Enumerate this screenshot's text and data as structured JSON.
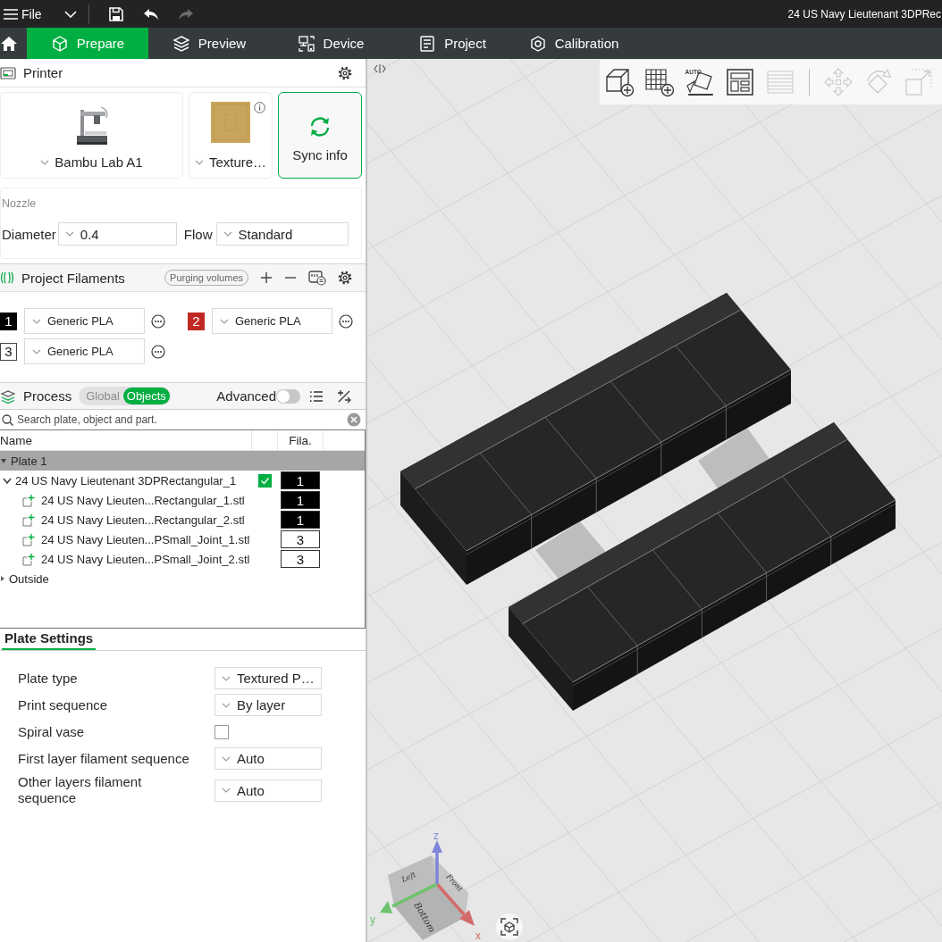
{
  "menu_bar": {
    "menu_label": "File",
    "actions": [
      {
        "kind": "save",
        "disabled": false
      },
      {
        "kind": "undo",
        "disabled": false
      },
      {
        "kind": "redo",
        "disabled": true
      }
    ],
    "title": "24 US Navy Lieutenant 3DPRec"
  },
  "tabs": [
    {
      "kind": "prepare",
      "label": "Prepare",
      "selected": true
    },
    {
      "kind": "preview",
      "label": "Preview",
      "selected": false
    },
    {
      "kind": "device",
      "label": "Device",
      "selected": false
    },
    {
      "kind": "project",
      "label": "Project",
      "selected": false
    },
    {
      "kind": "calibration",
      "label": "Calibration",
      "selected": false
    }
  ],
  "printer": {
    "title": "Printer",
    "printer_name": "Bambu Lab A1",
    "plate_name": "Texture…",
    "sync_button": "Sync info"
  },
  "nozzle": {
    "title": "Nozzle",
    "diameter_label": "Diameter",
    "diameter": "0.4",
    "flow_label": "Flow",
    "flow": "Standard"
  },
  "filaments": {
    "title": "Project Filaments",
    "purging_button": "Purging volumes",
    "items": [
      {
        "number": "1",
        "color": "#000000",
        "material": "Generic PLA"
      },
      {
        "number": "2",
        "color": "#c12a24",
        "material": "Generic PLA"
      },
      {
        "number": "3",
        "color": "#ffffff",
        "material": "Generic PLA"
      }
    ]
  },
  "process": {
    "title": "Process",
    "modes": [
      {
        "label": "Global",
        "selected": false
      },
      {
        "label": "Objects",
        "selected": true
      }
    ],
    "advanced_label": "Advanced",
    "advanced_on": false
  },
  "object_list": {
    "search_placeholder": "Search plate, object and part.",
    "columns": {
      "name": "Name",
      "filament": "Fila."
    },
    "tree": [
      {
        "kind": "plate",
        "label": "Plate 1",
        "expanded": true,
        "selected": true,
        "children": [
          {
            "kind": "object",
            "label": "24 US Navy Lieutenant 3DPRectangular_1",
            "expanded": true,
            "selected": false,
            "checked": true,
            "filament": "1",
            "color": "#000000",
            "children": [
              {
                "kind": "part",
                "label": "24 US Navy Lieuten...Rectangular_1.stl",
                "selected": false,
                "filament": "1",
                "color": "#000000"
              },
              {
                "kind": "part",
                "label": "24 US Navy Lieuten...Rectangular_2.stl",
                "selected": false,
                "filament": "1",
                "color": "#000000"
              },
              {
                "kind": "part",
                "label": "24 US Navy Lieuten...PSmall_Joint_1.stl",
                "selected": false,
                "filament": "3",
                "color": "#ffffff"
              },
              {
                "kind": "part",
                "label": "24 US Navy Lieuten...PSmall_Joint_2.stl",
                "selected": false,
                "filament": "3",
                "color": "#ffffff"
              }
            ]
          }
        ]
      },
      {
        "kind": "plate",
        "label": "Outside",
        "expanded": false,
        "selected": false
      }
    ]
  },
  "plate_settings": {
    "tabs": [
      {
        "label": "Plate Settings",
        "selected": true
      }
    ],
    "rows": [
      {
        "kind": "select",
        "label": "Plate type",
        "value": "Textured P…"
      },
      {
        "kind": "select",
        "label": "Print sequence",
        "value": "By layer"
      },
      {
        "kind": "checkbox",
        "label": "Spiral vase",
        "checked": false
      },
      {
        "kind": "select",
        "label": "First layer filament sequence",
        "value": "Auto"
      },
      {
        "kind": "select",
        "label": "Other layers filament sequence",
        "value": "Auto"
      }
    ]
  },
  "viewport": {
    "toolbar": [
      {
        "kind": "add-object",
        "disabled": false
      },
      {
        "kind": "add-plate",
        "disabled": false
      },
      {
        "kind": "auto-orient",
        "label": "AUTO",
        "disabled": false
      },
      {
        "kind": "arrange",
        "disabled": false
      },
      {
        "kind": "layers",
        "disabled": true
      },
      {
        "kind": "move",
        "disabled": true
      },
      {
        "kind": "rotate",
        "disabled": true
      },
      {
        "kind": "scale",
        "disabled": true
      }
    ],
    "gizmo": {
      "faces": [
        "Left",
        "Front",
        "Bottom"
      ],
      "axes": [
        {
          "label": "x",
          "color": "#d46b6b"
        },
        {
          "label": "y",
          "color": "#6cc36c"
        },
        {
          "label": "z",
          "color": "#7f84d8"
        }
      ]
    }
  }
}
